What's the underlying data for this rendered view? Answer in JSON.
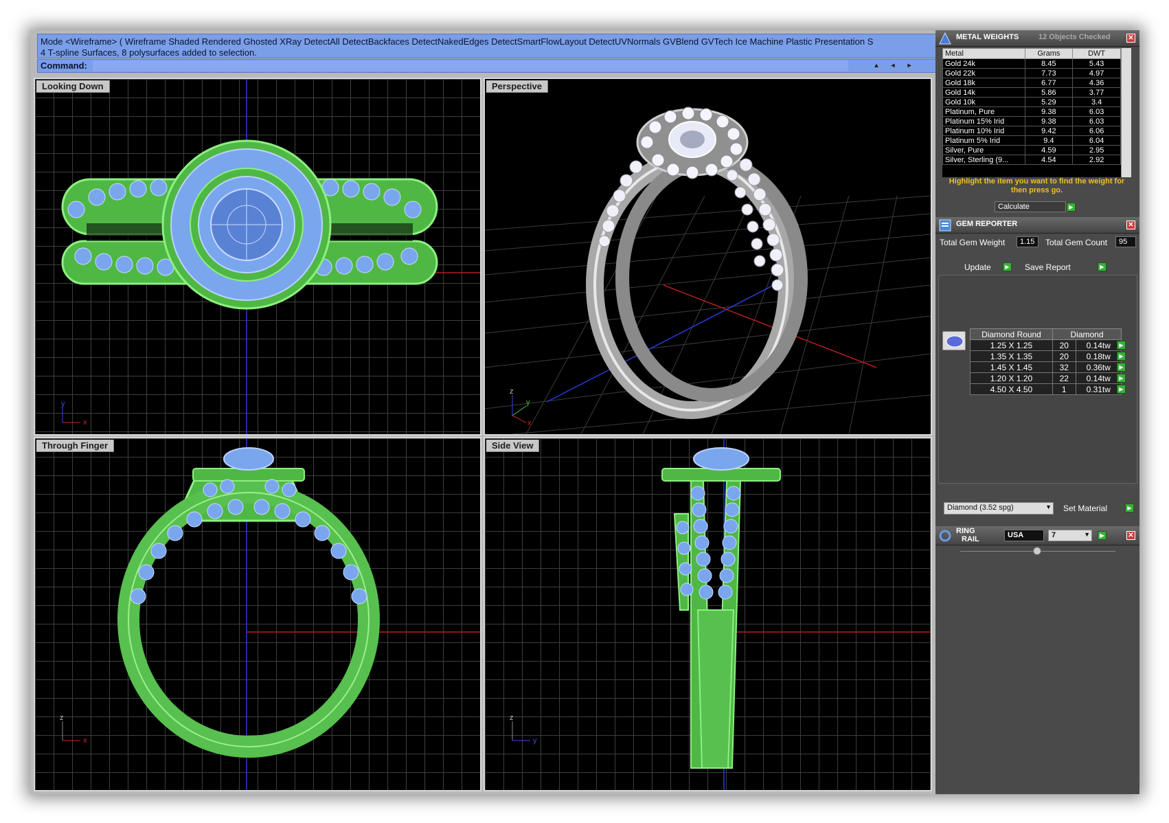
{
  "command": {
    "history_line1": "Mode <Wireframe> ( Wireframe  Shaded  Rendered  Ghosted  XRay  DetectAll  DetectBackfaces  DetectNakedEdges  DetectSmartFlowLayout  DetectUVNormals  GVBlend  GVTech  Ice  Machine  Plastic  Presentation  S",
    "history_line2": "4 T-spline Surfaces, 8 polysurfaces added to selection.",
    "prompt_label": "Command:"
  },
  "viewports": {
    "top_left": "Looking Down",
    "top_right": "Perspective",
    "bottom_left": "Through Finger",
    "bottom_right": "Side View"
  },
  "axes": {
    "x": "x",
    "y": "y",
    "z": "z"
  },
  "metal_weights": {
    "title": "METAL WEIGHTS",
    "status": "12 Objects Checked",
    "headers": [
      "Metal",
      "Grams",
      "DWT"
    ],
    "rows": [
      [
        "Gold 24k",
        "8.45",
        "5.43"
      ],
      [
        "Gold 22k",
        "7.73",
        "4.97"
      ],
      [
        "Gold 18k",
        "6.77",
        "4.36"
      ],
      [
        "Gold 14k",
        "5.86",
        "3.77"
      ],
      [
        "Gold 10k",
        "5.29",
        "3.4"
      ],
      [
        "Platinum, Pure",
        "9.38",
        "6.03"
      ],
      [
        "Platinum 15% Irid",
        "9.38",
        "6.03"
      ],
      [
        "Platinum 10% Irid",
        "9.42",
        "6.06"
      ],
      [
        "Platinum 5% Irid",
        "9.4",
        "6.04"
      ],
      [
        "Silver, Pure",
        "4.59",
        "2.95"
      ],
      [
        "Silver, Sterling (9...",
        "4.54",
        "2.92"
      ]
    ],
    "hint": "Highlight the item you want to find the weight for then press go.",
    "calculate_label": "Calculate"
  },
  "gem_reporter": {
    "title": "GEM REPORTER",
    "total_weight_label": "Total Gem Weight",
    "total_weight": "1.15",
    "total_count_label": "Total Gem Count",
    "total_count": "95",
    "update_label": "Update",
    "save_label": "Save Report",
    "table_header_shape": "Diamond Round",
    "table_header_material": "Diamond",
    "rows": [
      [
        "1.25 X 1.25",
        "20",
        "0.14tw"
      ],
      [
        "1.35 X 1.35",
        "20",
        "0.18tw"
      ],
      [
        "1.45 X 1.45",
        "32",
        "0.36tw"
      ],
      [
        "1.20 X 1.20",
        "22",
        "0.14tw"
      ],
      [
        "4.50 X 4.50",
        "1",
        "0.31tw"
      ]
    ],
    "material_select": "Diamond    (3.52 spg)",
    "set_material_label": "Set Material"
  },
  "ring_rail": {
    "title_line1": "RING",
    "title_line2": "RAIL",
    "region": "USA",
    "size": "7"
  },
  "colors": {
    "wire_green": "#66e060",
    "gem_blue": "#7aa6ee",
    "cmd_blue": "#7b9ee8",
    "panel": "#4a4a4a"
  }
}
